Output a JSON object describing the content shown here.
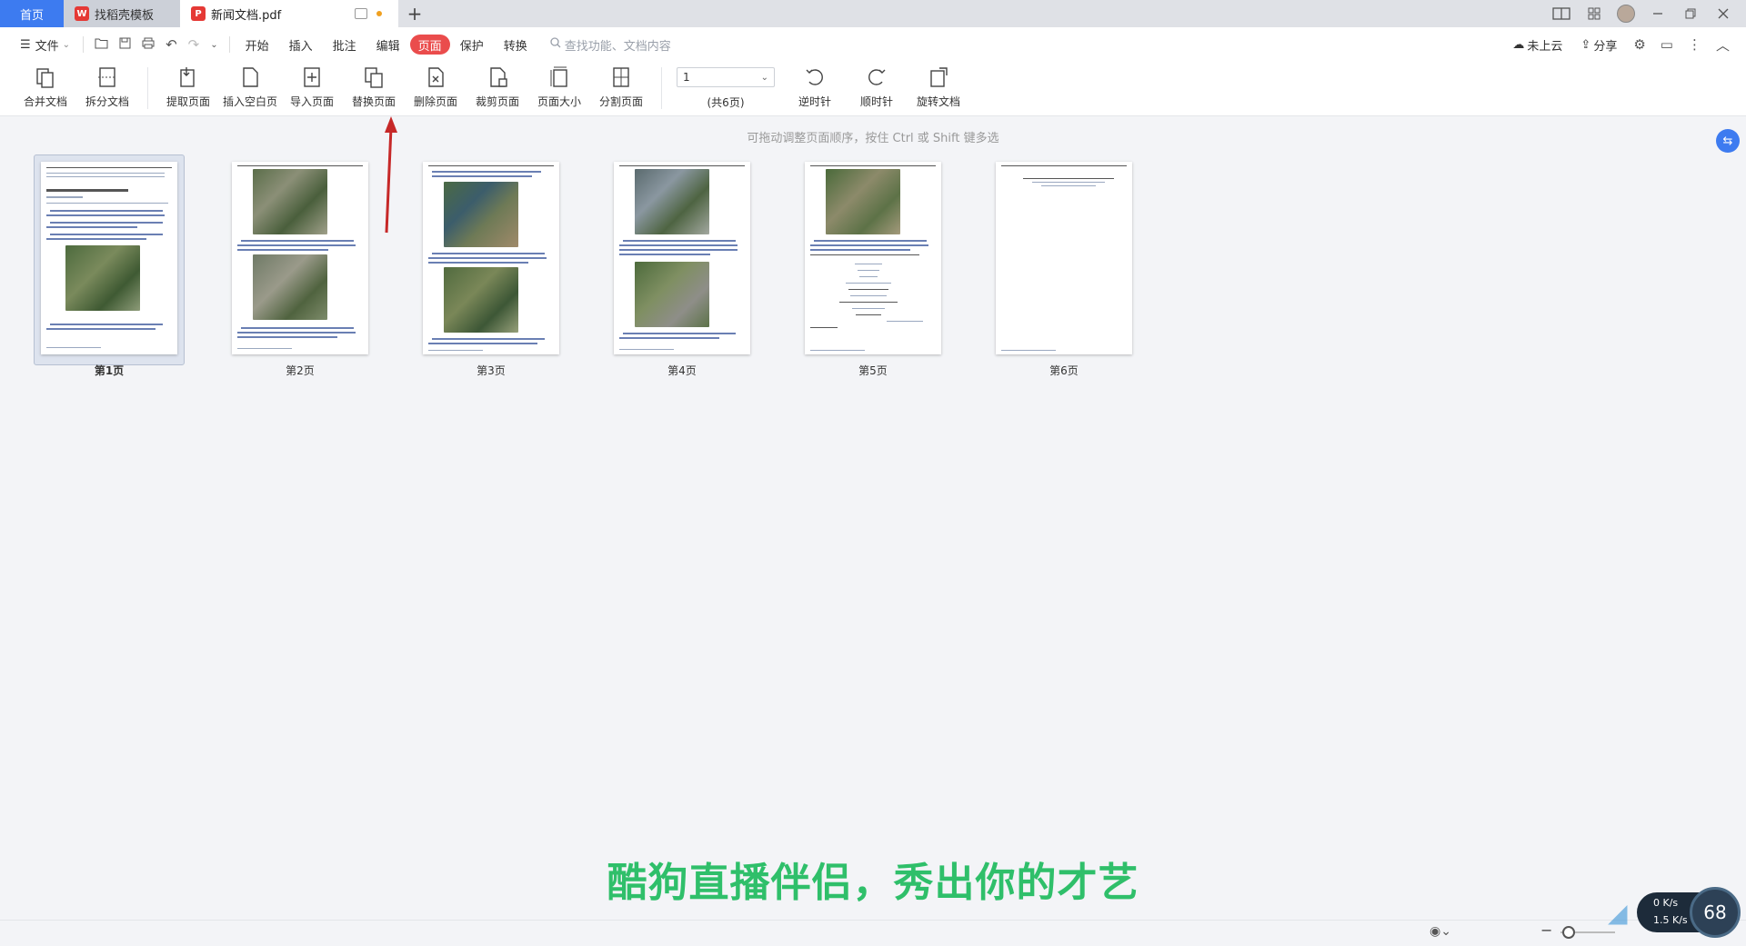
{
  "tabs": {
    "home": "首页",
    "template": "找稻壳模板",
    "document": "新闻文档.pdf",
    "new_tab": "+"
  },
  "menu": {
    "file": "文件",
    "tabs": [
      "开始",
      "插入",
      "批注",
      "编辑",
      "页面",
      "保护",
      "转换"
    ],
    "active_tab": "页面",
    "search_placeholder": "查找功能、文档内容",
    "cloud": "未上云",
    "share": "分享"
  },
  "ribbon": {
    "merge": "合并文档",
    "split": "拆分文档",
    "extract": "提取页面",
    "insert_blank": "插入空白页",
    "import": "导入页面",
    "replace": "替换页面",
    "delete": "删除页面",
    "crop": "裁剪页面",
    "page_size": "页面大小",
    "divide": "分割页面",
    "page_value": "1",
    "page_total": "(共6页)",
    "ccw": "逆时针",
    "cw": "顺时针",
    "rotate": "旋转文档"
  },
  "main": {
    "hint": "可拖动调整页面顺序，按住 Ctrl 或 Shift 键多选",
    "pages": [
      "第1页",
      "第2页",
      "第3页",
      "第4页",
      "第5页",
      "第6页"
    ],
    "selected_page": 1
  },
  "overlay": {
    "caption": "酷狗直播伴侣，秀出你的才艺",
    "net_down": "0 K/s",
    "net_up": "1.5 K/s",
    "cpu": "68"
  },
  "colors": {
    "accent": "#3d7bf0",
    "active_tab": "#ea4c4c",
    "caption": "#2fbf6a",
    "arrow": "#c62828"
  }
}
